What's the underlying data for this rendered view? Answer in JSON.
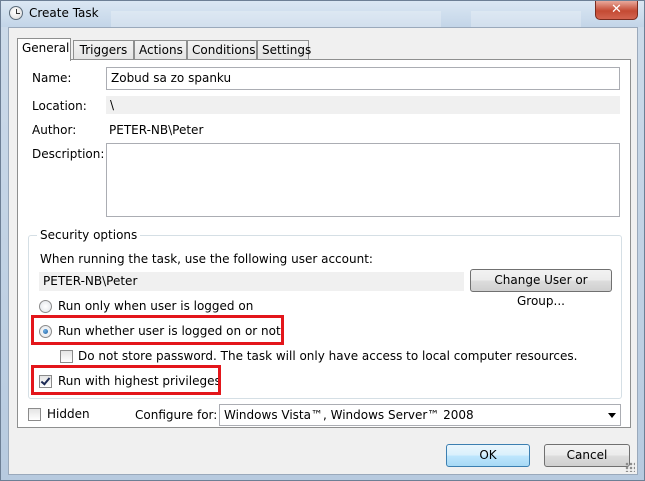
{
  "window": {
    "title": "Create Task",
    "close_label": "✕"
  },
  "tabs": [
    "General",
    "Triggers",
    "Actions",
    "Conditions",
    "Settings"
  ],
  "general": {
    "name_label": "Name:",
    "name_value": "Zobud sa zo spanku",
    "location_label": "Location:",
    "location_value": "\\",
    "author_label": "Author:",
    "author_value": "PETER-NB\\Peter",
    "description_label": "Description:",
    "description_value": ""
  },
  "security": {
    "legend": "Security options",
    "account_prompt": "When running the task, use the following user account:",
    "account_value": "PETER-NB\\Peter",
    "change_user_button": "Change User or Group...",
    "radio_logged_on": "Run only when user is logged on",
    "radio_whether": "Run whether user is logged on or not",
    "do_not_store_password": "Do not store password.  The task will only have access to local computer resources.",
    "highest_privileges": "Run with highest privileges",
    "selected_radio": "whether",
    "do_not_store_checked": false,
    "highest_privileges_checked": true
  },
  "bottom": {
    "hidden_label": "Hidden",
    "hidden_checked": false,
    "configure_label": "Configure for:",
    "configure_value": "Windows Vista™, Windows Server™ 2008"
  },
  "buttons": {
    "ok": "OK",
    "cancel": "Cancel"
  },
  "colors": {
    "highlight_red": "#e3161b",
    "accent_blue": "#3c7fb1"
  }
}
